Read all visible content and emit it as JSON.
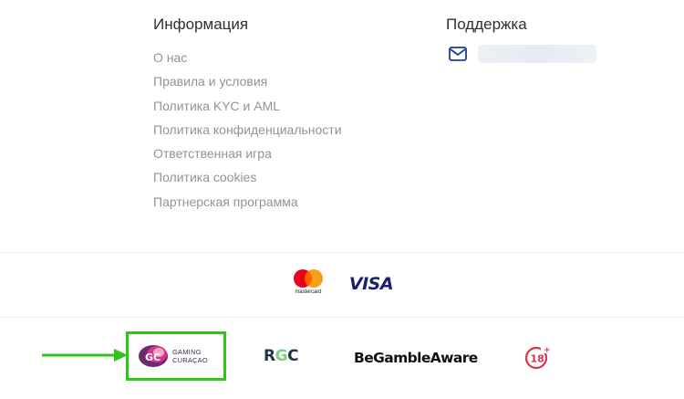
{
  "info": {
    "title": "Информация",
    "links": [
      "О нас",
      "Правила и условия",
      "Политика KYC и AML",
      "Политика конфиденциальности",
      "Ответственная игра",
      "Политика cookies",
      "Партнерская программа"
    ]
  },
  "support": {
    "title": "Поддержка",
    "icon": "mail-icon"
  },
  "payments": {
    "mastercard_text": "mastercard",
    "visa_text": "VISA"
  },
  "badges": {
    "gc_line1": "GAMING",
    "gc_line2": "CURAÇAO",
    "gc_logo_text": "GC",
    "rgc_text_r": "R",
    "rgc_text_g": "G",
    "rgc_text_c": "C",
    "begamble_text": "BeGambleAware",
    "age_text": "18"
  },
  "colors": {
    "highlight": "#2fc51a",
    "link": "#8f939a",
    "heading": "#2b2f36",
    "accent_blue": "#1f3b9c"
  }
}
